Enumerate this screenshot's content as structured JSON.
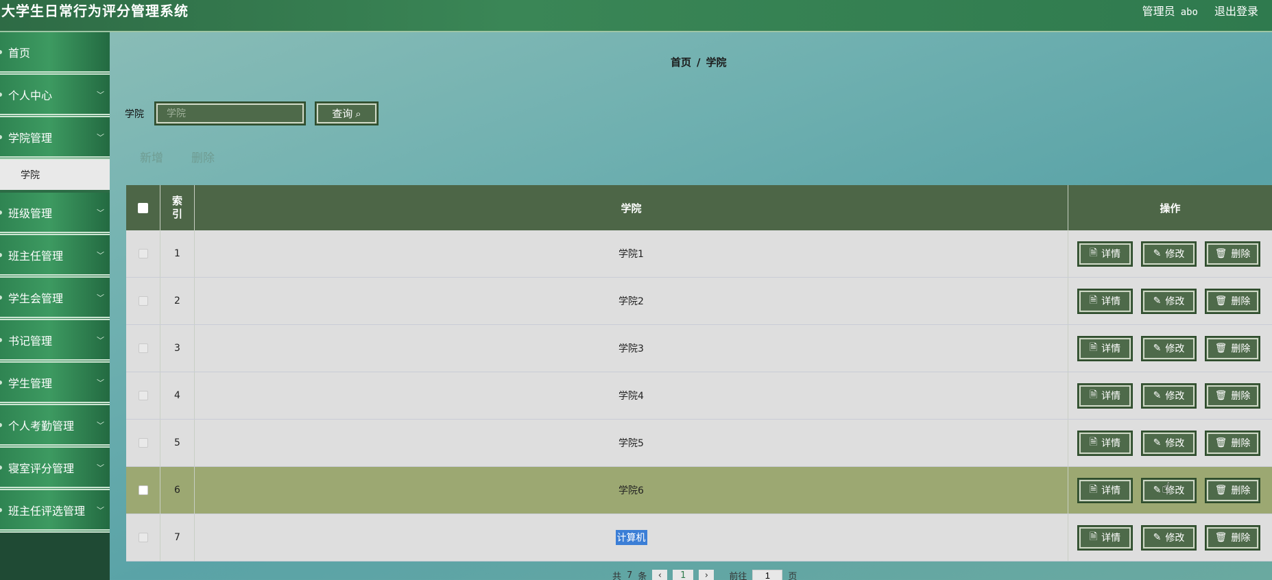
{
  "header": {
    "title": "大学生日常行为评分管理系统",
    "role": "管理员",
    "username": "abo",
    "logout": "退出登录"
  },
  "sidebar": {
    "items": [
      {
        "label": "首页",
        "has_chevron": false
      },
      {
        "label": "个人中心",
        "has_chevron": true
      },
      {
        "label": "学院管理",
        "has_chevron": true
      },
      {
        "label": "班级管理",
        "has_chevron": true
      },
      {
        "label": "班主任管理",
        "has_chevron": true
      },
      {
        "label": "学生会管理",
        "has_chevron": true
      },
      {
        "label": "书记管理",
        "has_chevron": true
      },
      {
        "label": "学生管理",
        "has_chevron": true
      },
      {
        "label": "个人考勤管理",
        "has_chevron": true
      },
      {
        "label": "寝室评分管理",
        "has_chevron": true
      },
      {
        "label": "班主任评选管理",
        "has_chevron": true
      }
    ],
    "subitem": "学院"
  },
  "breadcrumb": {
    "home": "首页",
    "sep": "/",
    "current": "学院"
  },
  "search": {
    "label": "学院",
    "placeholder": "学院",
    "button": "查询"
  },
  "actions": {
    "add": "新增",
    "delete": "删除"
  },
  "table": {
    "headers": {
      "index": "索引",
      "name": "学院",
      "ops": "操作"
    },
    "rows": [
      {
        "index": "1",
        "name": "学院1"
      },
      {
        "index": "2",
        "name": "学院2"
      },
      {
        "index": "3",
        "name": "学院3"
      },
      {
        "index": "4",
        "name": "学院4"
      },
      {
        "index": "5",
        "name": "学院5"
      },
      {
        "index": "6",
        "name": "学院6"
      },
      {
        "index": "7",
        "name": "计算机"
      }
    ],
    "buttons": {
      "detail": "详情",
      "edit": "修改",
      "delete": "删除"
    }
  },
  "pagination": {
    "total_prefix": "共",
    "total": "7",
    "total_suffix": "条",
    "page": "1",
    "goto_prefix": "前往",
    "goto_value": "1",
    "goto_suffix": "页"
  },
  "colors": {
    "header": "#2e6b45",
    "table_header": "#4d6647",
    "highlight_row": "#9ca872",
    "button": "#4e6a4a"
  }
}
